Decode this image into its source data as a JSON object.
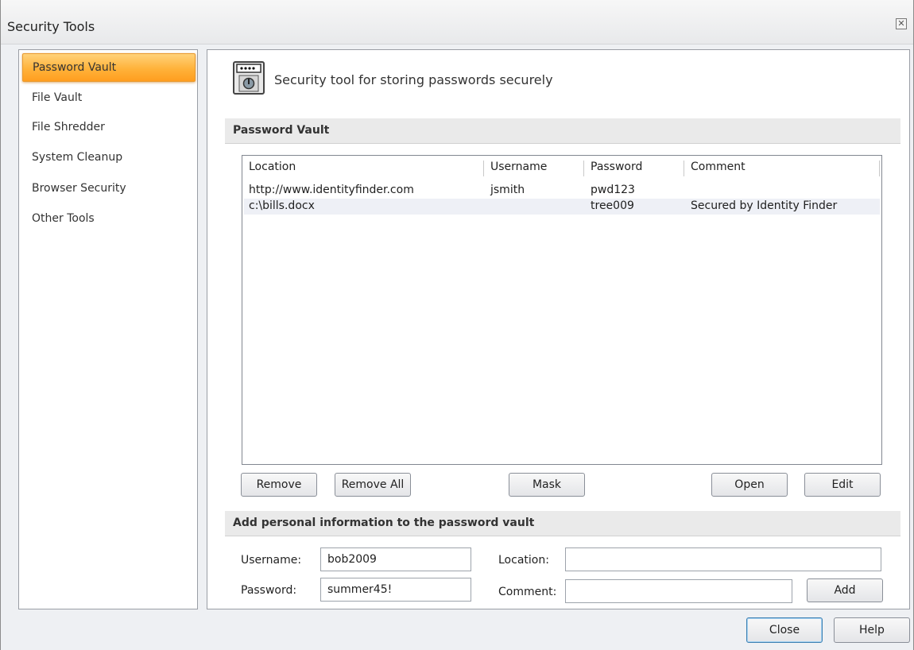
{
  "window": {
    "title": "Security Tools",
    "close_glyph": "✕"
  },
  "sidebar": {
    "items": [
      {
        "label": "Password Vault",
        "selected": true
      },
      {
        "label": "File Vault"
      },
      {
        "label": "File Shredder"
      },
      {
        "label": "System Cleanup"
      },
      {
        "label": "Browser Security"
      },
      {
        "label": "Other Tools"
      }
    ]
  },
  "main": {
    "icon": "vault-safe-icon",
    "description": "Security tool for storing passwords securely",
    "vault_section_title": "Password Vault",
    "table": {
      "columns": [
        "Location",
        "Username",
        "Password",
        "Comment"
      ],
      "rows": [
        {
          "location": "http://www.identityfinder.com",
          "username": "jsmith",
          "password": "pwd123",
          "comment": ""
        },
        {
          "location": "c:\\bills.docx",
          "username": "",
          "password": "tree009",
          "comment": "Secured by Identity Finder"
        }
      ]
    },
    "buttons": {
      "remove": "Remove",
      "remove_all": "Remove All",
      "mask": "Mask",
      "open": "Open",
      "edit": "Edit"
    },
    "add_section_title": "Add personal information to the password vault",
    "form": {
      "username_label": "Username:",
      "username_value": "bob2009",
      "password_label": "Password:",
      "password_value": "summer45!",
      "location_label": "Location:",
      "location_value": "",
      "comment_label": "Comment:",
      "comment_value": "",
      "add_label": "Add"
    }
  },
  "footer": {
    "close_label": "Close",
    "help_label": "Help"
  },
  "colors": {
    "selected_item": "#ffb23a",
    "accent_border": "#3c7fb1"
  }
}
